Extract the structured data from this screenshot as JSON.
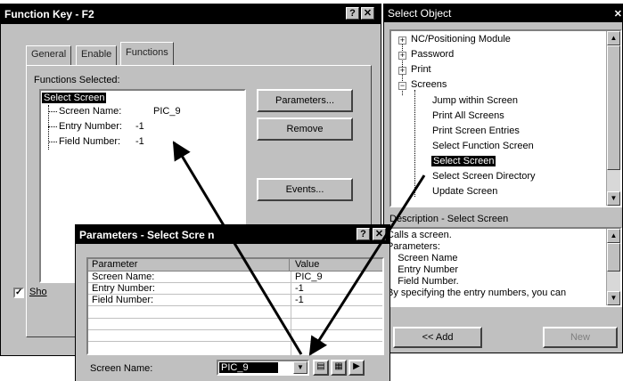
{
  "function_key_dialog": {
    "title": "Function Key - F2",
    "tabs": [
      "General",
      "Enable",
      "Functions"
    ],
    "functions_label": "Functions Selected:",
    "tree": {
      "root": "Select Screen",
      "children": [
        {
          "name": "Screen Name:",
          "value": "PIC_9"
        },
        {
          "name": "Entry Number:",
          "value": "-1"
        },
        {
          "name": "Field Number:",
          "value": "-1"
        }
      ]
    },
    "buttons": {
      "parameters": "Parameters...",
      "remove": "Remove",
      "events": "Events..."
    },
    "show_checkbox_label": "Sho"
  },
  "select_object_dialog": {
    "title": "Select Object",
    "tree_items": [
      {
        "label": "NC/Positioning Module",
        "level": 0,
        "expander": "+"
      },
      {
        "label": "Password",
        "level": 0,
        "expander": "+"
      },
      {
        "label": "Print",
        "level": 0,
        "expander": "+"
      },
      {
        "label": "Screens",
        "level": 0,
        "expander": "-"
      },
      {
        "label": "Jump within Screen",
        "level": 1
      },
      {
        "label": "Print All Screens",
        "level": 1
      },
      {
        "label": "Print Screen Entries",
        "level": 1
      },
      {
        "label": "Select Function Screen",
        "level": 1
      },
      {
        "label": "Select Screen",
        "level": 1,
        "selected": true
      },
      {
        "label": "Select Screen Directory",
        "level": 1
      },
      {
        "label": "Update Screen",
        "level": 1
      }
    ],
    "description_header": "Description - Select Screen",
    "description_lines": [
      "Calls a screen.",
      "Parameters:",
      "    Screen Name",
      "    Entry Number",
      "    Field Number.",
      "By specifying the entry numbers, you can"
    ],
    "buttons": {
      "add": "<< Add",
      "new": "New"
    }
  },
  "parameters_dialog": {
    "title": "Parameters - Select Scre n",
    "columns": [
      "Parameter",
      "Value"
    ],
    "rows": [
      {
        "parameter": "Screen Name:",
        "value": "PIC_9"
      },
      {
        "parameter": "Entry Number:",
        "value": "-1"
      },
      {
        "parameter": "Field Number:",
        "value": "-1"
      }
    ],
    "field_label": "Screen Name:",
    "field_value": "PIC_9"
  }
}
